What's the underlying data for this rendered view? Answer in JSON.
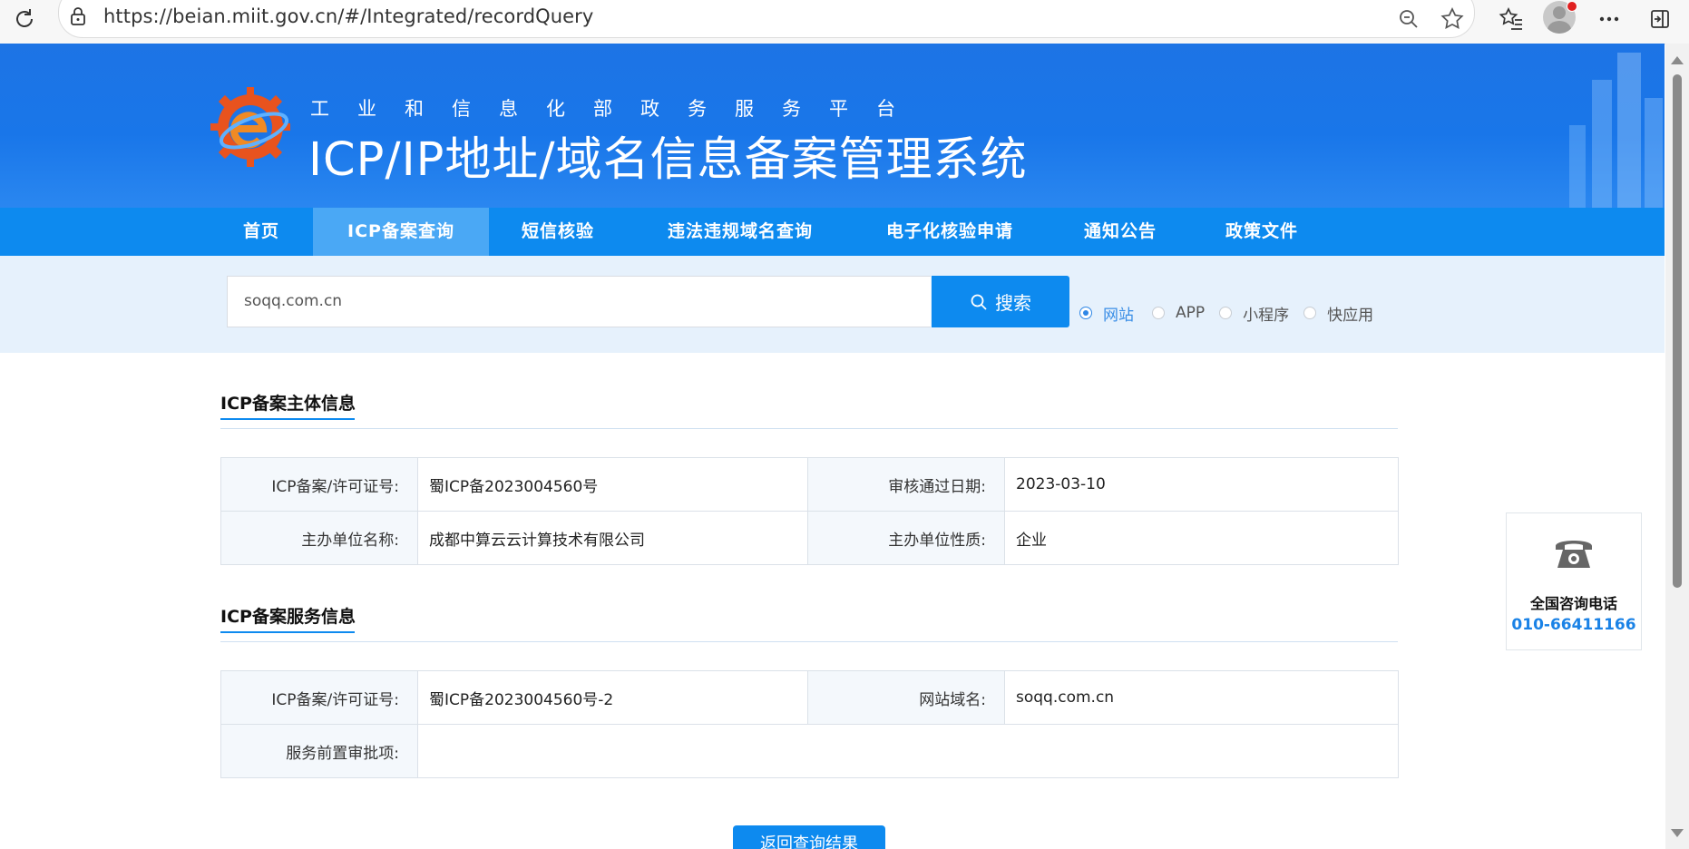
{
  "browser": {
    "url": "https://beian.miit.gov.cn/#/Integrated/recordQuery"
  },
  "header": {
    "ministry": "工业和信息化部政务服务平台",
    "system_title": "ICP/IP地址/域名信息备案管理系统"
  },
  "nav": {
    "items": [
      {
        "label": "首页"
      },
      {
        "label": "ICP备案查询",
        "active": true
      },
      {
        "label": "短信核验"
      },
      {
        "label": "违法违规域名查询"
      },
      {
        "label": "电子化核验申请"
      },
      {
        "label": "通知公告"
      },
      {
        "label": "政策文件"
      }
    ]
  },
  "search": {
    "value": "soqq.com.cn",
    "button_label": "搜索",
    "options": [
      {
        "label": "网站",
        "checked": true
      },
      {
        "label": "APP"
      },
      {
        "label": "小程序"
      },
      {
        "label": "快应用"
      }
    ]
  },
  "entity_section": {
    "title": "ICP备案主体信息",
    "rows": [
      {
        "label1": "ICP备案/许可证号:",
        "value1": "蜀ICP备2023004560号",
        "label2": "审核通过日期:",
        "value2": "2023-03-10"
      },
      {
        "label1": "主办单位名称:",
        "value1": "成都中算云云计算技术有限公司",
        "label2": "主办单位性质:",
        "value2": "企业"
      }
    ]
  },
  "service_section": {
    "title": "ICP备案服务信息",
    "row1": {
      "label1": "ICP备案/许可证号:",
      "value1": "蜀ICP备2023004560号-2",
      "label2": "网站域名:",
      "value2": "soqq.com.cn"
    },
    "row2": {
      "label": "服务前置审批项:",
      "value": ""
    }
  },
  "consult": {
    "label": "全国咨询电话",
    "phone": "010-66411166"
  },
  "back_button": "返回查询结果",
  "colors": {
    "primary": "#0d8aef",
    "banner": "#1d74e5",
    "search_strip": "#e6f1fc"
  }
}
